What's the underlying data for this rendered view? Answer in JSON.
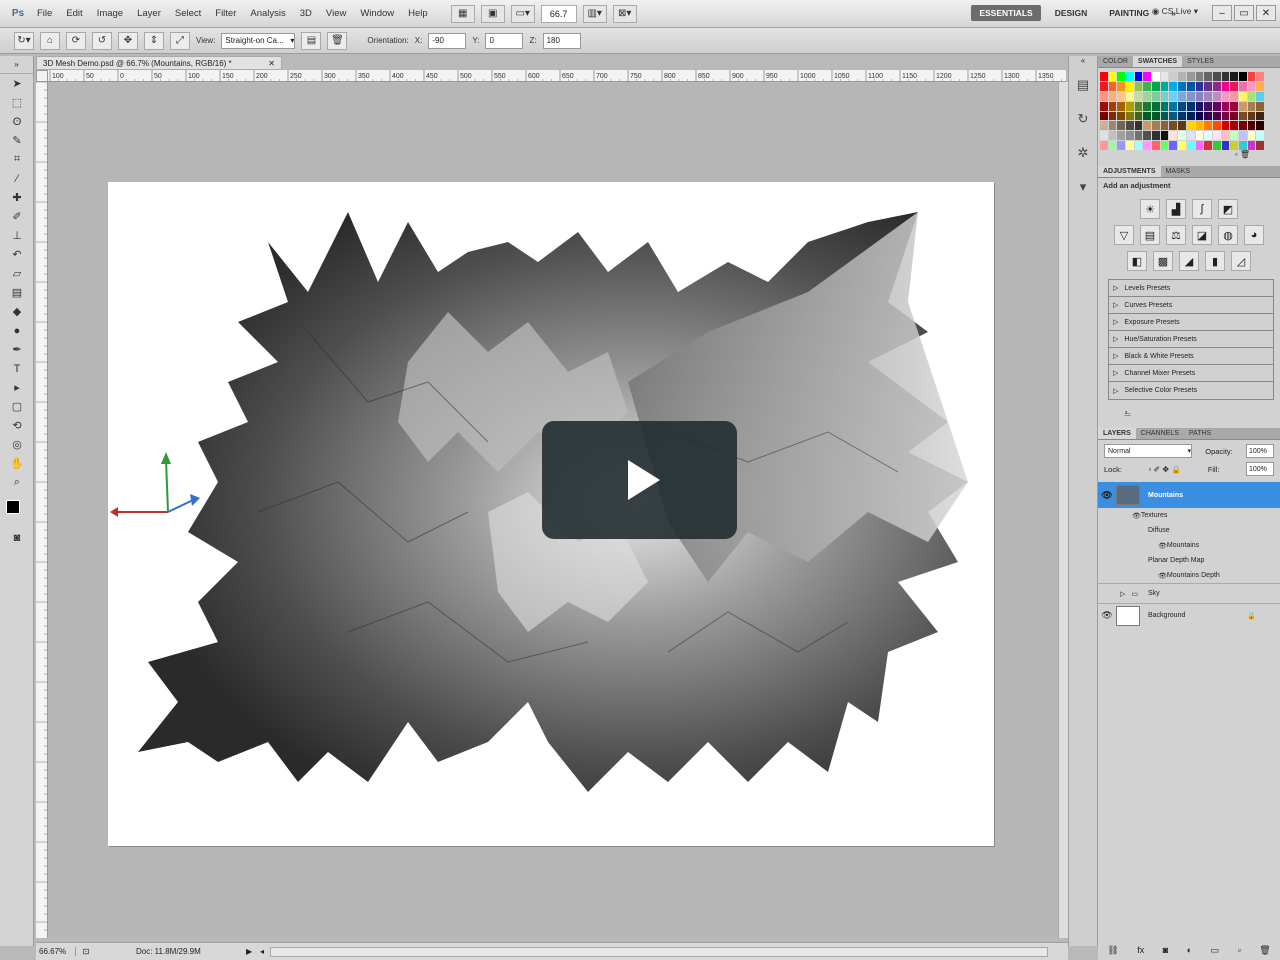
{
  "app": {
    "logo": "Ps",
    "menus": [
      "File",
      "Edit",
      "Image",
      "Layer",
      "Select",
      "Filter",
      "Analysis",
      "3D",
      "View",
      "Window",
      "Help"
    ],
    "zoom": "66.7",
    "workspaces": [
      "ESSENTIALS",
      "DESIGN",
      "PAINTING"
    ],
    "active_workspace": "ESSENTIALS",
    "more_workspaces": "»",
    "cs_live": "CS Live"
  },
  "options_bar": {
    "view_label": "View:",
    "view_value": "Straight-on Ca...",
    "orientation_label": "Orientation:",
    "x_label": "X:",
    "x_value": "-90",
    "y_label": "Y:",
    "y_value": "0",
    "z_label": "Z:",
    "z_value": "180"
  },
  "document": {
    "tab_title": "3D Mesh Demo.psd @ 66.7% (Mountains, RGB/16) *",
    "ruler_ticks": [
      "100",
      "50",
      "0",
      "50",
      "100",
      "150",
      "200",
      "250",
      "300",
      "350",
      "400",
      "450",
      "500",
      "550",
      "600",
      "650",
      "700",
      "750",
      "800",
      "850",
      "900",
      "950",
      "1000",
      "1050",
      "1100",
      "1150",
      "1200",
      "1250",
      "1300",
      "1350"
    ],
    "status_zoom": "66.67%",
    "status_doc": "Doc: 11.8M/29.9M"
  },
  "panels": {
    "swatch_tabs": [
      "COLOR",
      "SWATCHES",
      "STYLES"
    ],
    "adjustment_tabs": [
      "ADJUSTMENTS",
      "MASKS"
    ],
    "add_adjustment": "Add an adjustment",
    "presets": [
      "Levels Presets",
      "Curves Presets",
      "Exposure Presets",
      "Hue/Saturation Presets",
      "Black & White Presets",
      "Channel Mixer Presets",
      "Selective Color Presets"
    ],
    "layer_tabs": [
      "LAYERS",
      "CHANNELS",
      "PATHS"
    ],
    "blend_mode": "Normal",
    "opacity_label": "Opacity:",
    "opacity_value": "100%",
    "lock_label": "Lock:",
    "fill_label": "Fill:",
    "fill_value": "100%",
    "layers": {
      "mountains": "Mountains",
      "textures": "Textures",
      "diffuse": "Diffuse",
      "mountains_tex": "Mountains",
      "depth_map": "Planar Depth Map",
      "mountains_depth": "Mountains Depth",
      "sky": "Sky",
      "background": "Background"
    }
  }
}
